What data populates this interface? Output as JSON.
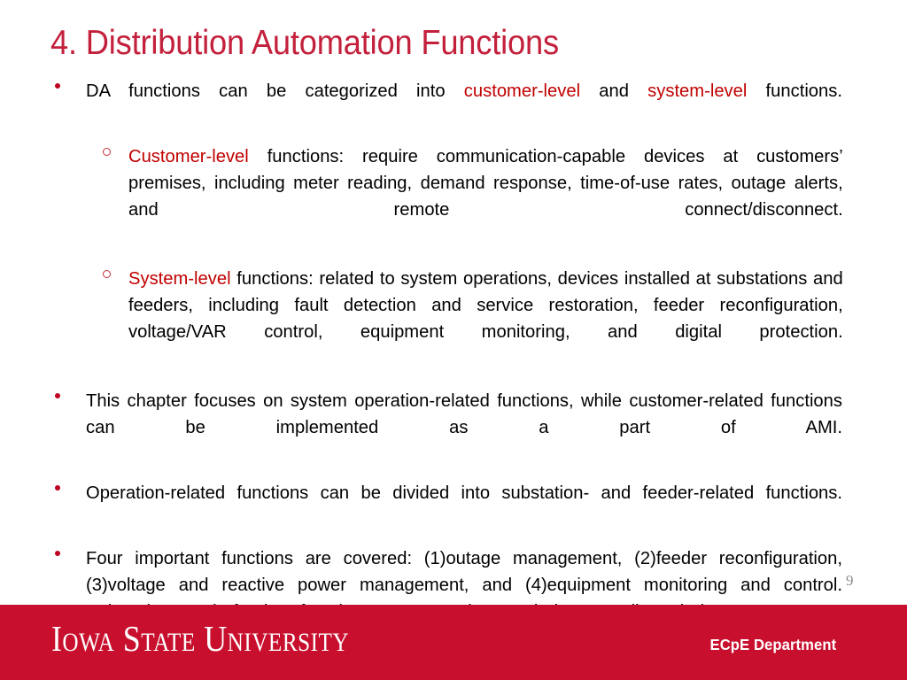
{
  "slide": {
    "title": "4. Distribution Automation Functions",
    "page_number": "9",
    "accent_red": "#C8102E",
    "title_red": "#C3203C",
    "inline_red": "#C00000"
  },
  "bullets": [
    {
      "level": 1,
      "marker": "dot",
      "segments": [
        {
          "text": "DA functions can be categorized into ",
          "style": "normal"
        },
        {
          "text": "customer-level",
          "style": "red"
        },
        {
          "text": " and ",
          "style": "normal"
        },
        {
          "text": "system-level",
          "style": "red"
        },
        {
          "text": " functions.",
          "style": "normal"
        }
      ]
    },
    {
      "level": 2,
      "marker": "circle",
      "segments": [
        {
          "text": "Customer-level",
          "style": "red"
        },
        {
          "text": " functions: require communication-capable devices at customers’ premises, including meter reading, demand response, time-of-use rates, outage alerts, and remote connect/disconnect.",
          "style": "normal"
        }
      ]
    },
    {
      "level": 2,
      "marker": "circle",
      "segments": [
        {
          "text": "System-level",
          "style": "red"
        },
        {
          "text": " functions: related to system operations, devices installed at substations and feeders, including fault detection and service restoration, feeder reconfiguration, voltage/VAR control, equipment monitoring, and digital protection.",
          "style": "normal"
        }
      ]
    },
    {
      "level": 1,
      "marker": "dot",
      "segments": [
        {
          "text": "This chapter focuses on system operation-related functions, while customer-related functions can be implemented as a part of AMI.",
          "style": "normal"
        }
      ]
    },
    {
      "level": 1,
      "marker": "dot",
      "segments": [
        {
          "text": "Operation-related functions can be divided into substation- and feeder-related functions.",
          "style": "normal"
        }
      ]
    },
    {
      "level": 1,
      "marker": "dot",
      "segments": [
        {
          "text": "Four important functions are covered: (1)outage management, (2)feeder reconfiguration, (3)voltage and reactive power management, and (4)equipment monitoring and control. Substation and feeder functions can overlap and be coordinated in some cases.",
          "style": "normal"
        }
      ]
    }
  ],
  "footer": {
    "logo": "Iowa State University",
    "department": "ECpE Department"
  }
}
